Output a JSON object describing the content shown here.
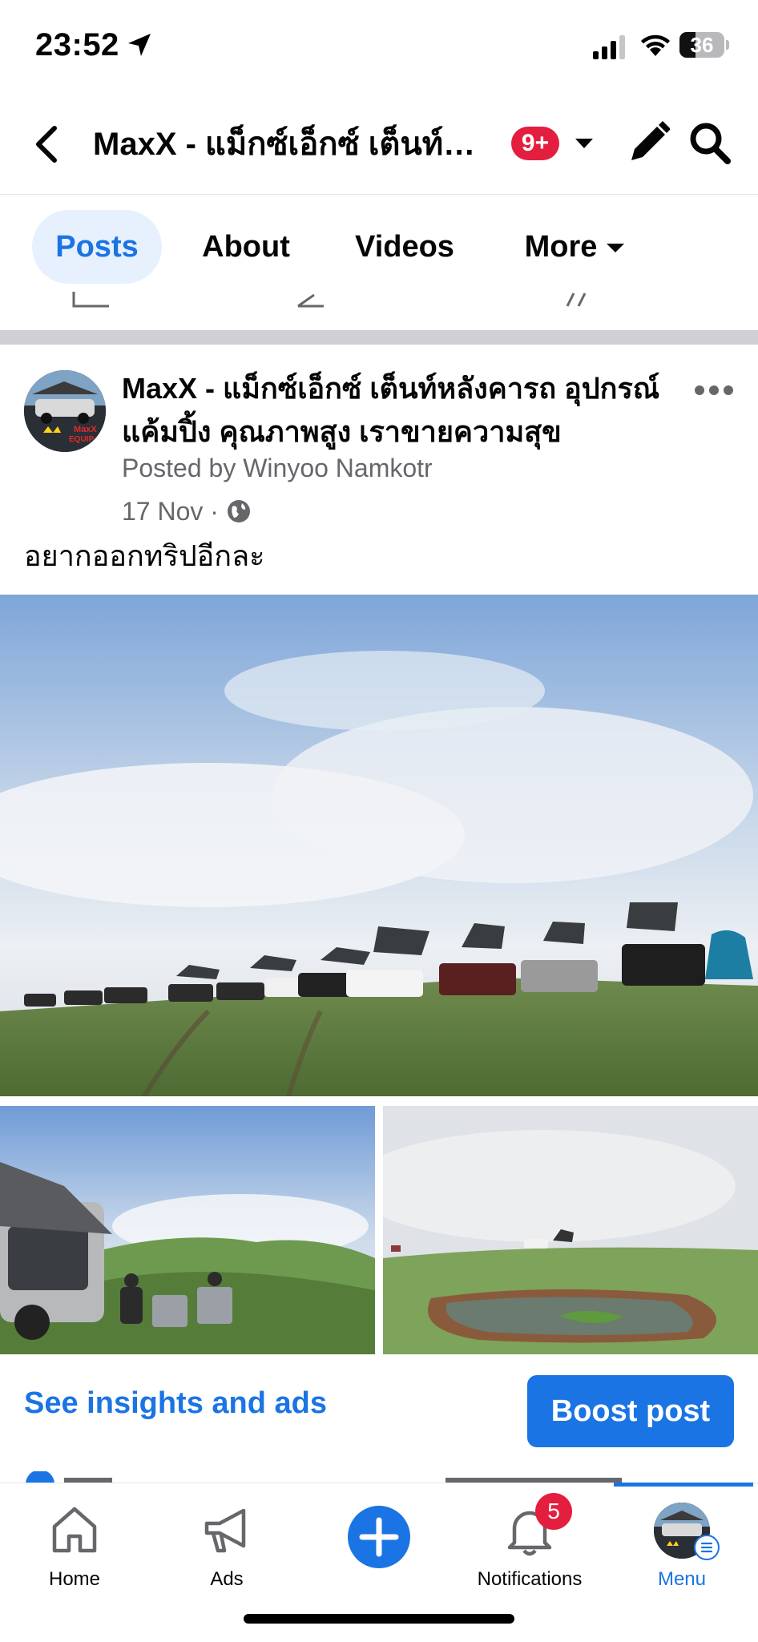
{
  "status_bar": {
    "time": "23:52",
    "battery": "36",
    "battery_level": 0.36
  },
  "header": {
    "title": "MaxX - แม็กซ์เอ็กซ์ เต็นท์หลังคารถ อุปกรณ์แค้มปิ้ง คุณภาพสูง เราขายความสุข",
    "notification_count": "9+"
  },
  "tabs": [
    {
      "label": "Posts",
      "active": true
    },
    {
      "label": "About",
      "active": false
    },
    {
      "label": "Videos",
      "active": false
    },
    {
      "label": "More",
      "active": false
    }
  ],
  "post": {
    "author": "MaxX - แม็กซ์เอ็กซ์ เต็นท์หลังคารถ อุปกรณ์แค้มปิ้ง คุณภาพสูง เราขายความสุข",
    "posted_by": "Posted by Winyoo Namkotr",
    "date": "17 Nov",
    "date_separator": "·",
    "text": "อยากออกทริปอีกละ",
    "avatar_text": {
      "line1": "MaxX",
      "line2": "EQUIP"
    }
  },
  "actions": {
    "insights_label": "See insights and ads",
    "boost_label": "Boost post"
  },
  "bottom_nav": {
    "items": [
      {
        "label": "Home",
        "icon": "home-icon"
      },
      {
        "label": "Ads",
        "icon": "megaphone-icon"
      },
      {
        "label": "",
        "icon": "plus-icon"
      },
      {
        "label": "Notifications",
        "icon": "bell-icon",
        "badge": "5"
      },
      {
        "label": "Menu",
        "icon": "menu-avatar",
        "active": true
      }
    ]
  },
  "colors": {
    "accent": "#1b74e4",
    "badge": "#e41e3f",
    "secondary_text": "#65676b"
  }
}
